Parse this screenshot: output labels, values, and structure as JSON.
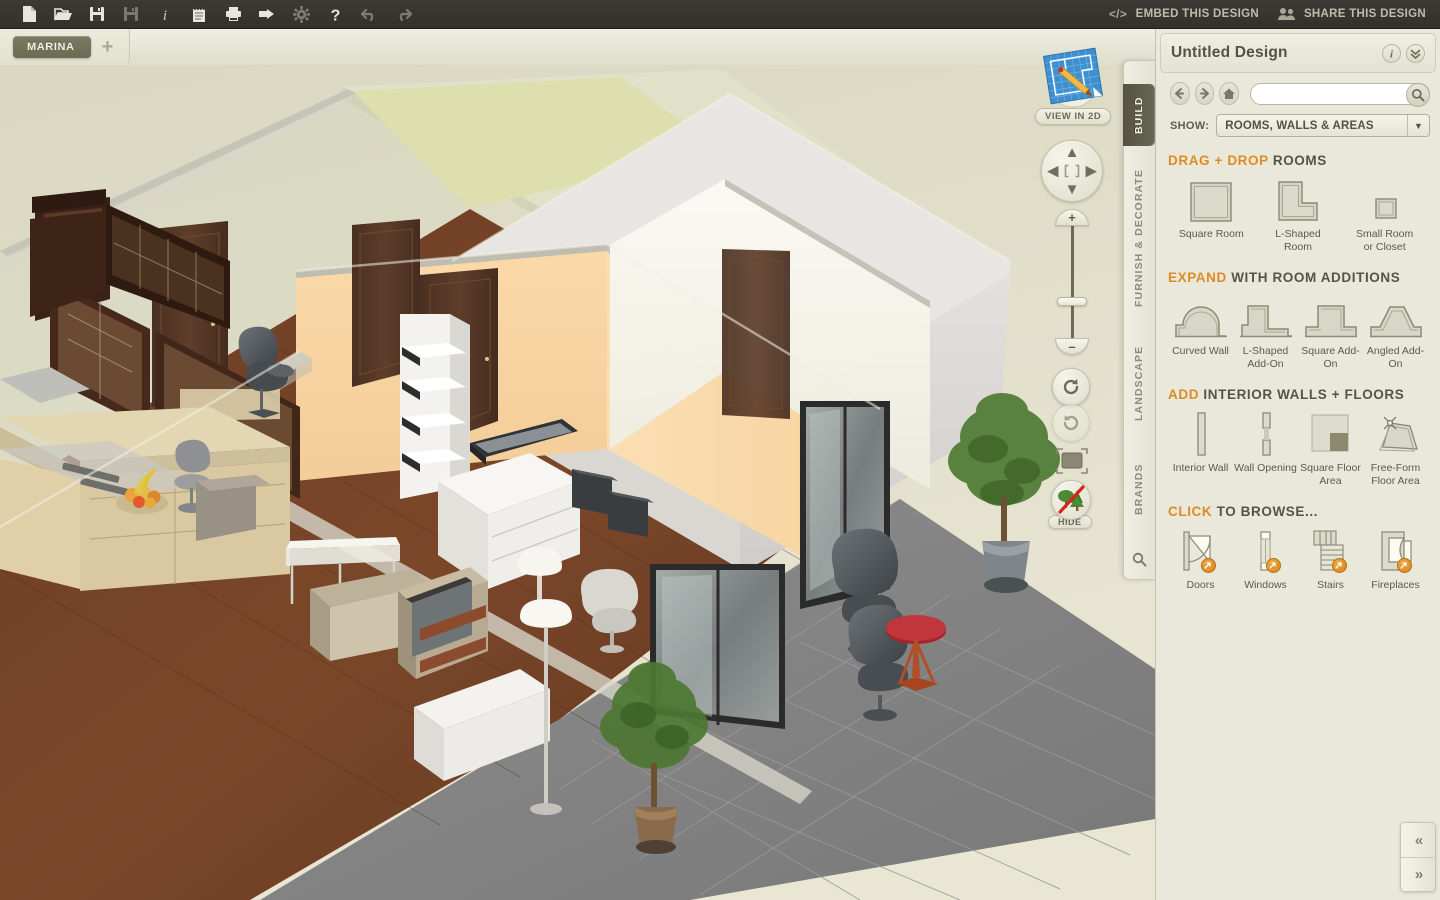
{
  "toolbar": {
    "buttons": [
      {
        "name": "new-document-icon",
        "label": "New",
        "disabled": false
      },
      {
        "name": "open-folder-icon",
        "label": "Open",
        "disabled": false
      },
      {
        "name": "save-icon",
        "label": "Save",
        "disabled": false
      },
      {
        "name": "save-as-icon",
        "label": "Save As",
        "disabled": true
      },
      {
        "name": "info-icon",
        "label": "Info",
        "disabled": false
      },
      {
        "name": "notes-icon",
        "label": "Notes",
        "disabled": false
      },
      {
        "name": "print-icon",
        "label": "Print",
        "disabled": false
      },
      {
        "name": "export-icon",
        "label": "Export",
        "disabled": false
      },
      {
        "name": "settings-gear-icon",
        "label": "Settings",
        "disabled": true
      },
      {
        "name": "help-icon",
        "label": "Help",
        "disabled": false
      },
      {
        "name": "undo-icon",
        "label": "Undo",
        "disabled": true
      },
      {
        "name": "redo-icon",
        "label": "Redo",
        "disabled": true
      }
    ],
    "embed_label": "EMBED THIS DESIGN",
    "share_label": "SHARE THIS DESIGN"
  },
  "tabstrip": {
    "active_tab": "MARINA",
    "add_tab_label": "+"
  },
  "viewport": {
    "view_2d_label": "VIEW IN 2D",
    "hide_label": "HIDE",
    "zoom_plus": "+",
    "zoom_minus": "–",
    "collapse_label": "«",
    "expand_label": "»"
  },
  "vertical_tabs": [
    {
      "label": "BUILD",
      "active": true
    },
    {
      "label": "FURNISH & DECORATE",
      "active": false
    },
    {
      "label": "LANDSCAPE",
      "active": false
    },
    {
      "label": "BRANDS",
      "active": false
    }
  ],
  "panel": {
    "title": "Untitled Design",
    "info_label": "i",
    "collapse_label": "»",
    "search_value": "",
    "search_placeholder": "",
    "show_label": "SHOW:",
    "show_value": "ROOMS, WALLS & AREAS"
  },
  "sections": [
    {
      "highlight": "DRAG + DROP",
      "rest": "ROOMS",
      "columns": 3,
      "items": [
        {
          "label": "Square Room",
          "icon": "square-room-icon"
        },
        {
          "label": "L-Shaped Room",
          "icon": "l-shaped-room-icon"
        },
        {
          "label": "Small Room or Closet",
          "icon": "small-room-icon"
        }
      ]
    },
    {
      "highlight": "EXPAND",
      "rest": "WITH ROOM ADDITIONS",
      "columns": 4,
      "items": [
        {
          "label": "Curved Wall",
          "icon": "curved-wall-icon"
        },
        {
          "label": "L-Shaped Add-On",
          "icon": "l-shaped-addon-icon"
        },
        {
          "label": "Square Add-On",
          "icon": "square-addon-icon"
        },
        {
          "label": "Angled Add-On",
          "icon": "angled-addon-icon"
        }
      ]
    },
    {
      "highlight": "ADD",
      "rest": "INTERIOR WALLS + FLOORS",
      "columns": 4,
      "items": [
        {
          "label": "Interior Wall",
          "icon": "interior-wall-icon"
        },
        {
          "label": "Wall Opening",
          "icon": "wall-opening-icon"
        },
        {
          "label": "Square Floor Area",
          "icon": "square-floor-area-icon"
        },
        {
          "label": "Free-Form Floor Area",
          "icon": "free-form-floor-area-icon"
        }
      ]
    },
    {
      "highlight": "CLICK",
      "rest": "TO BROWSE...",
      "columns": 4,
      "items": [
        {
          "label": "Doors",
          "icon": "door-icon",
          "badge": true
        },
        {
          "label": "Windows",
          "icon": "window-icon",
          "badge": true
        },
        {
          "label": "Stairs",
          "icon": "stairs-icon",
          "badge": true
        },
        {
          "label": "Fireplaces",
          "icon": "fireplace-icon",
          "badge": true
        }
      ]
    }
  ],
  "colors": {
    "accent_orange": "#dd8c24",
    "panel_bg": "#e9e8db",
    "toolbar_bg": "#3c3a34",
    "canvas_bg": "#dedcc6",
    "tab_active": "#6d6a54",
    "text_dark": "#55533f"
  }
}
